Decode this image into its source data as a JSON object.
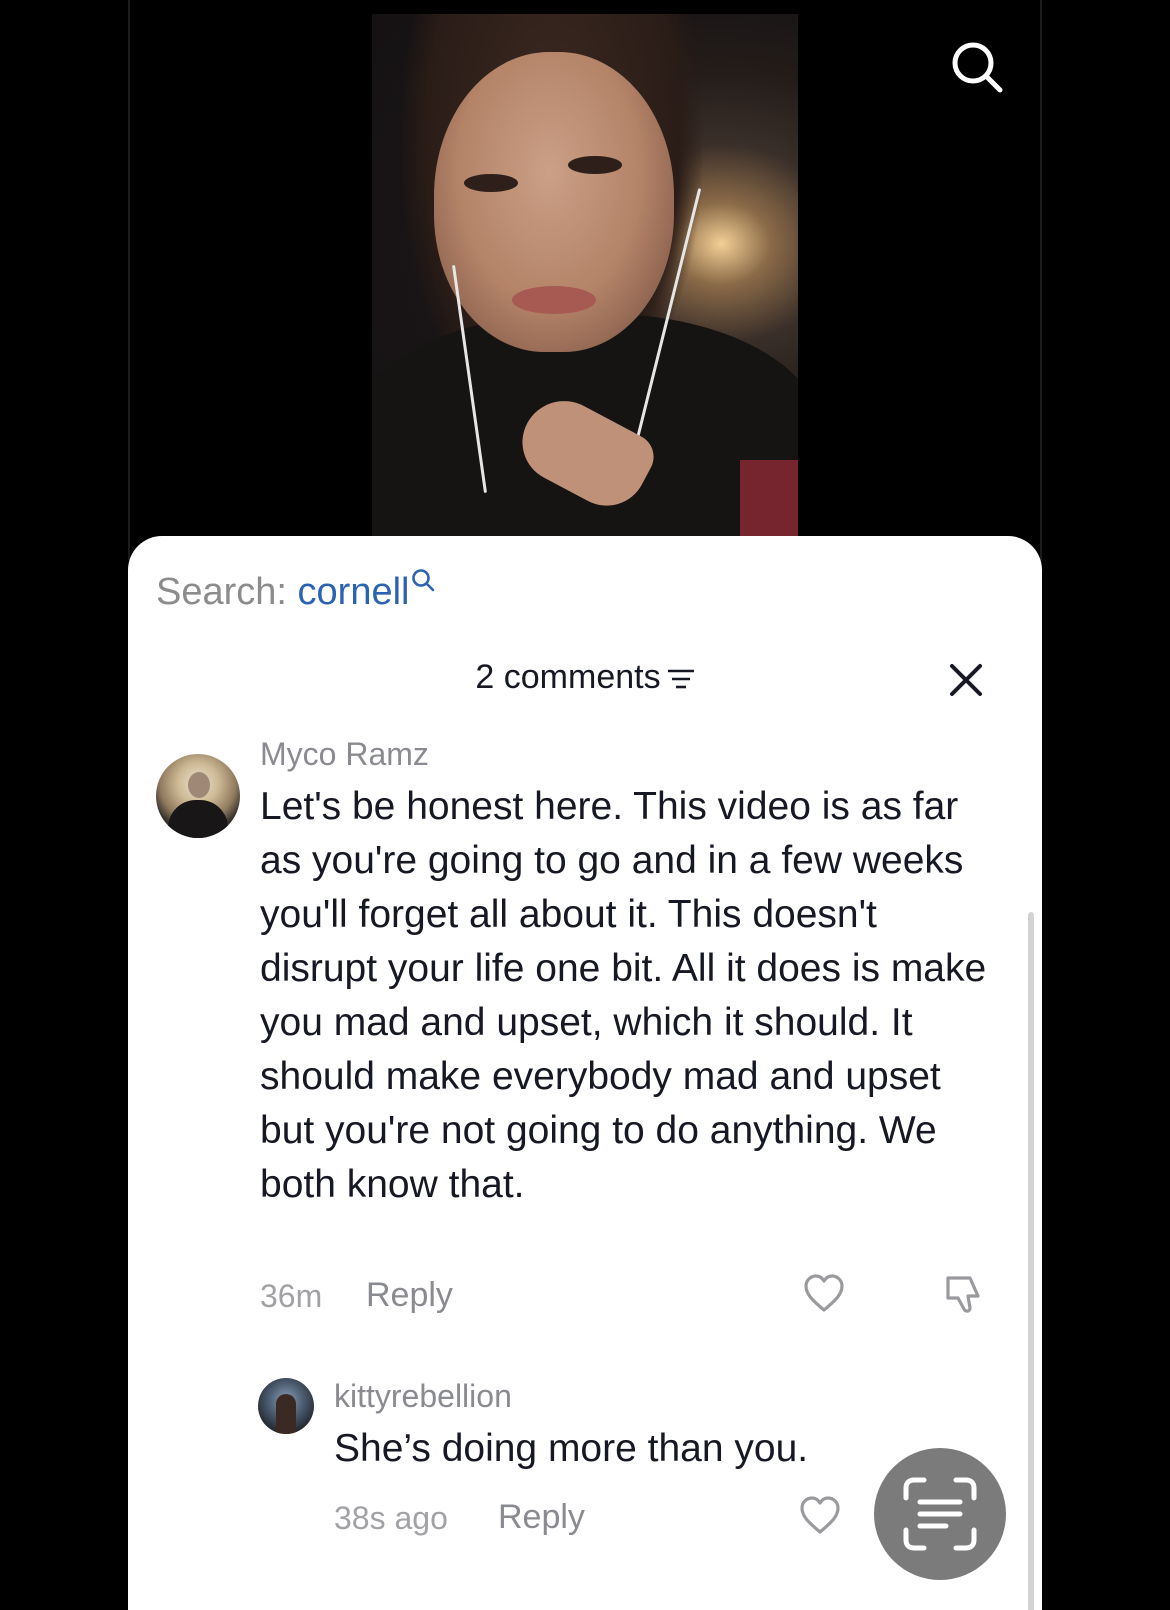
{
  "top": {
    "search_icon": "search-icon"
  },
  "sheet": {
    "search_label": "Search: ",
    "search_query": "cornell",
    "comments_count_label": "2 comments",
    "filter_icon": "filter-lines-icon",
    "close_icon": "close-icon"
  },
  "comments": [
    {
      "author": "Myco Ramz",
      "text": "Let's be honest here. This video is as far as you're going to go and in a few weeks you'll forget all about it. This doesn't disrupt your life one bit. All it does is make you mad and upset, which it should. It should make everybody mad and upset but you're not going to do anything. We both know that.",
      "time": "36m",
      "reply_label": "Reply"
    },
    {
      "author": "kittyrebellion",
      "text": "She’s doing more than you.",
      "time": "38s ago",
      "reply_label": "Reply"
    }
  ],
  "floating_action": {
    "icon": "text-scan-icon"
  },
  "colors": {
    "background": "#000000",
    "sheet": "#ffffff",
    "query_link": "#2b63b2",
    "muted_text": "#8a8b91",
    "primary_text": "#161823",
    "scan_button": "#7b7b7b"
  }
}
